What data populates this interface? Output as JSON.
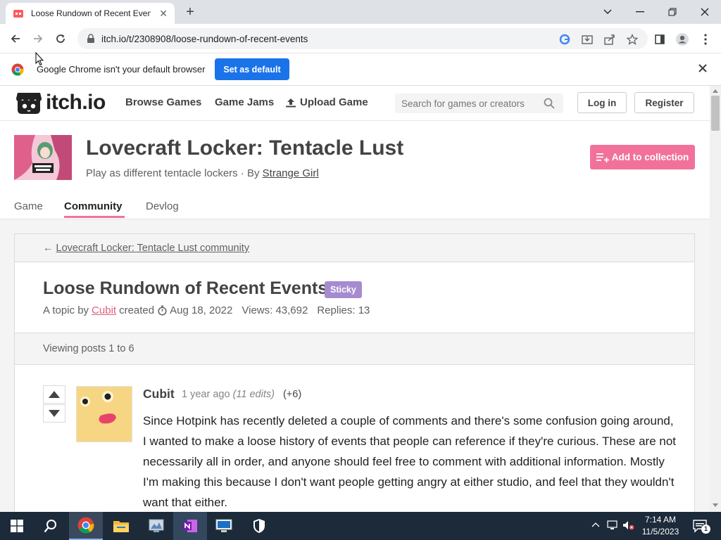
{
  "browser": {
    "tab_title": "Loose Rundown of Recent Events",
    "url": "itch.io/t/2308908/loose-rundown-of-recent-events",
    "infobar_message": "Google Chrome isn't your default browser",
    "set_default_label": "Set as default"
  },
  "site": {
    "logo_text": "itch.io",
    "nav": [
      "Browse Games",
      "Game Jams",
      "Upload Game"
    ],
    "search_placeholder": "Search for games or creators",
    "login_label": "Log in",
    "register_label": "Register"
  },
  "game": {
    "title": "Lovecraft Locker: Tentacle Lust",
    "tagline": "Play as different tentacle lockers · By ",
    "author": "Strange Girl",
    "add_collection_label": "Add to collection",
    "tabs": [
      "Game",
      "Community",
      "Devlog"
    ]
  },
  "topic": {
    "back_link": "Lovecraft Locker: Tentacle Lust community",
    "back_arrow": "←",
    "title": "Loose Rundown of Recent Events",
    "badge": "Sticky",
    "prefix": "A topic by",
    "author": "Cubit",
    "created_word": "created",
    "date": "Aug 18, 2022",
    "views": "Views: 43,692",
    "replies": "Replies: 13",
    "viewing": "Viewing posts 1 to 6"
  },
  "post": {
    "author": "Cubit",
    "age": "1 year ago",
    "edits": "(11 edits)",
    "score": "(+6)",
    "body": "Since Hotpink has recently deleted a couple of comments and there's some confusion going around, I wanted to make a loose history of events that people can reference if they're curious. These are not necessarily all in order, and anyone should feel free to comment with additional information. Mostly I'm making this because I don't want people getting angry at either studio, and feel that they wouldn't want that either."
  },
  "taskbar": {
    "time": "7:14 AM",
    "date": "11/5/2023",
    "notification_count": "1"
  },
  "colors": {
    "accent": "#f2719a",
    "chrome_blue": "#1a73e8",
    "taskbar": "#1c2a3a"
  }
}
